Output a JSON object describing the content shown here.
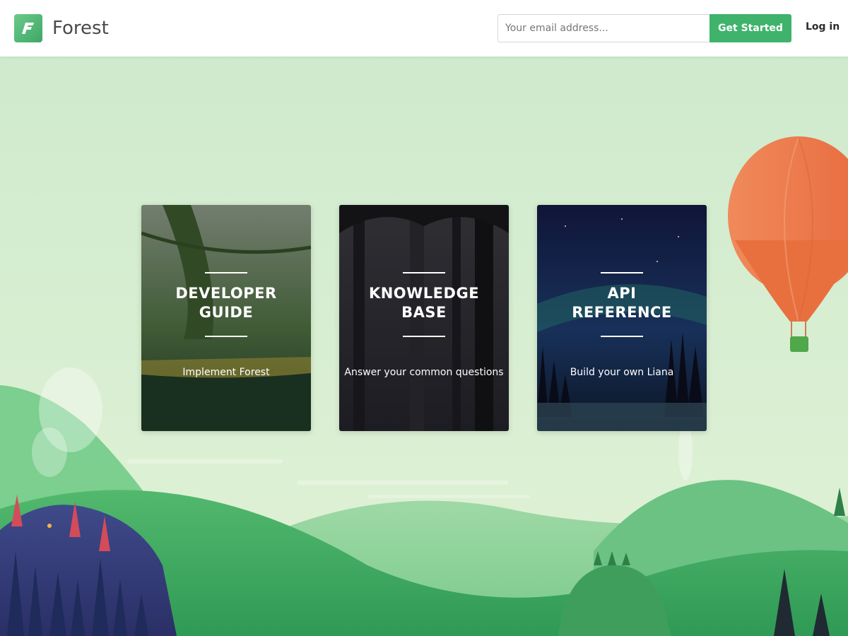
{
  "header": {
    "logo_letter": "F",
    "logo_text": "Forest",
    "email_placeholder": "Your email address...",
    "cta_label": "Get Started",
    "login_label": "Log in"
  },
  "cards": [
    {
      "title": "DEVELOPER\nGUIDE",
      "description": "Implement Forest"
    },
    {
      "title": "KNOWLEDGE\nBASE",
      "description": "Answer your common questions"
    },
    {
      "title": "API\nREFERENCE",
      "description": "Build your own Liana"
    }
  ],
  "colors": {
    "brand": "#3fb36b",
    "background": "#d3ecd2"
  }
}
